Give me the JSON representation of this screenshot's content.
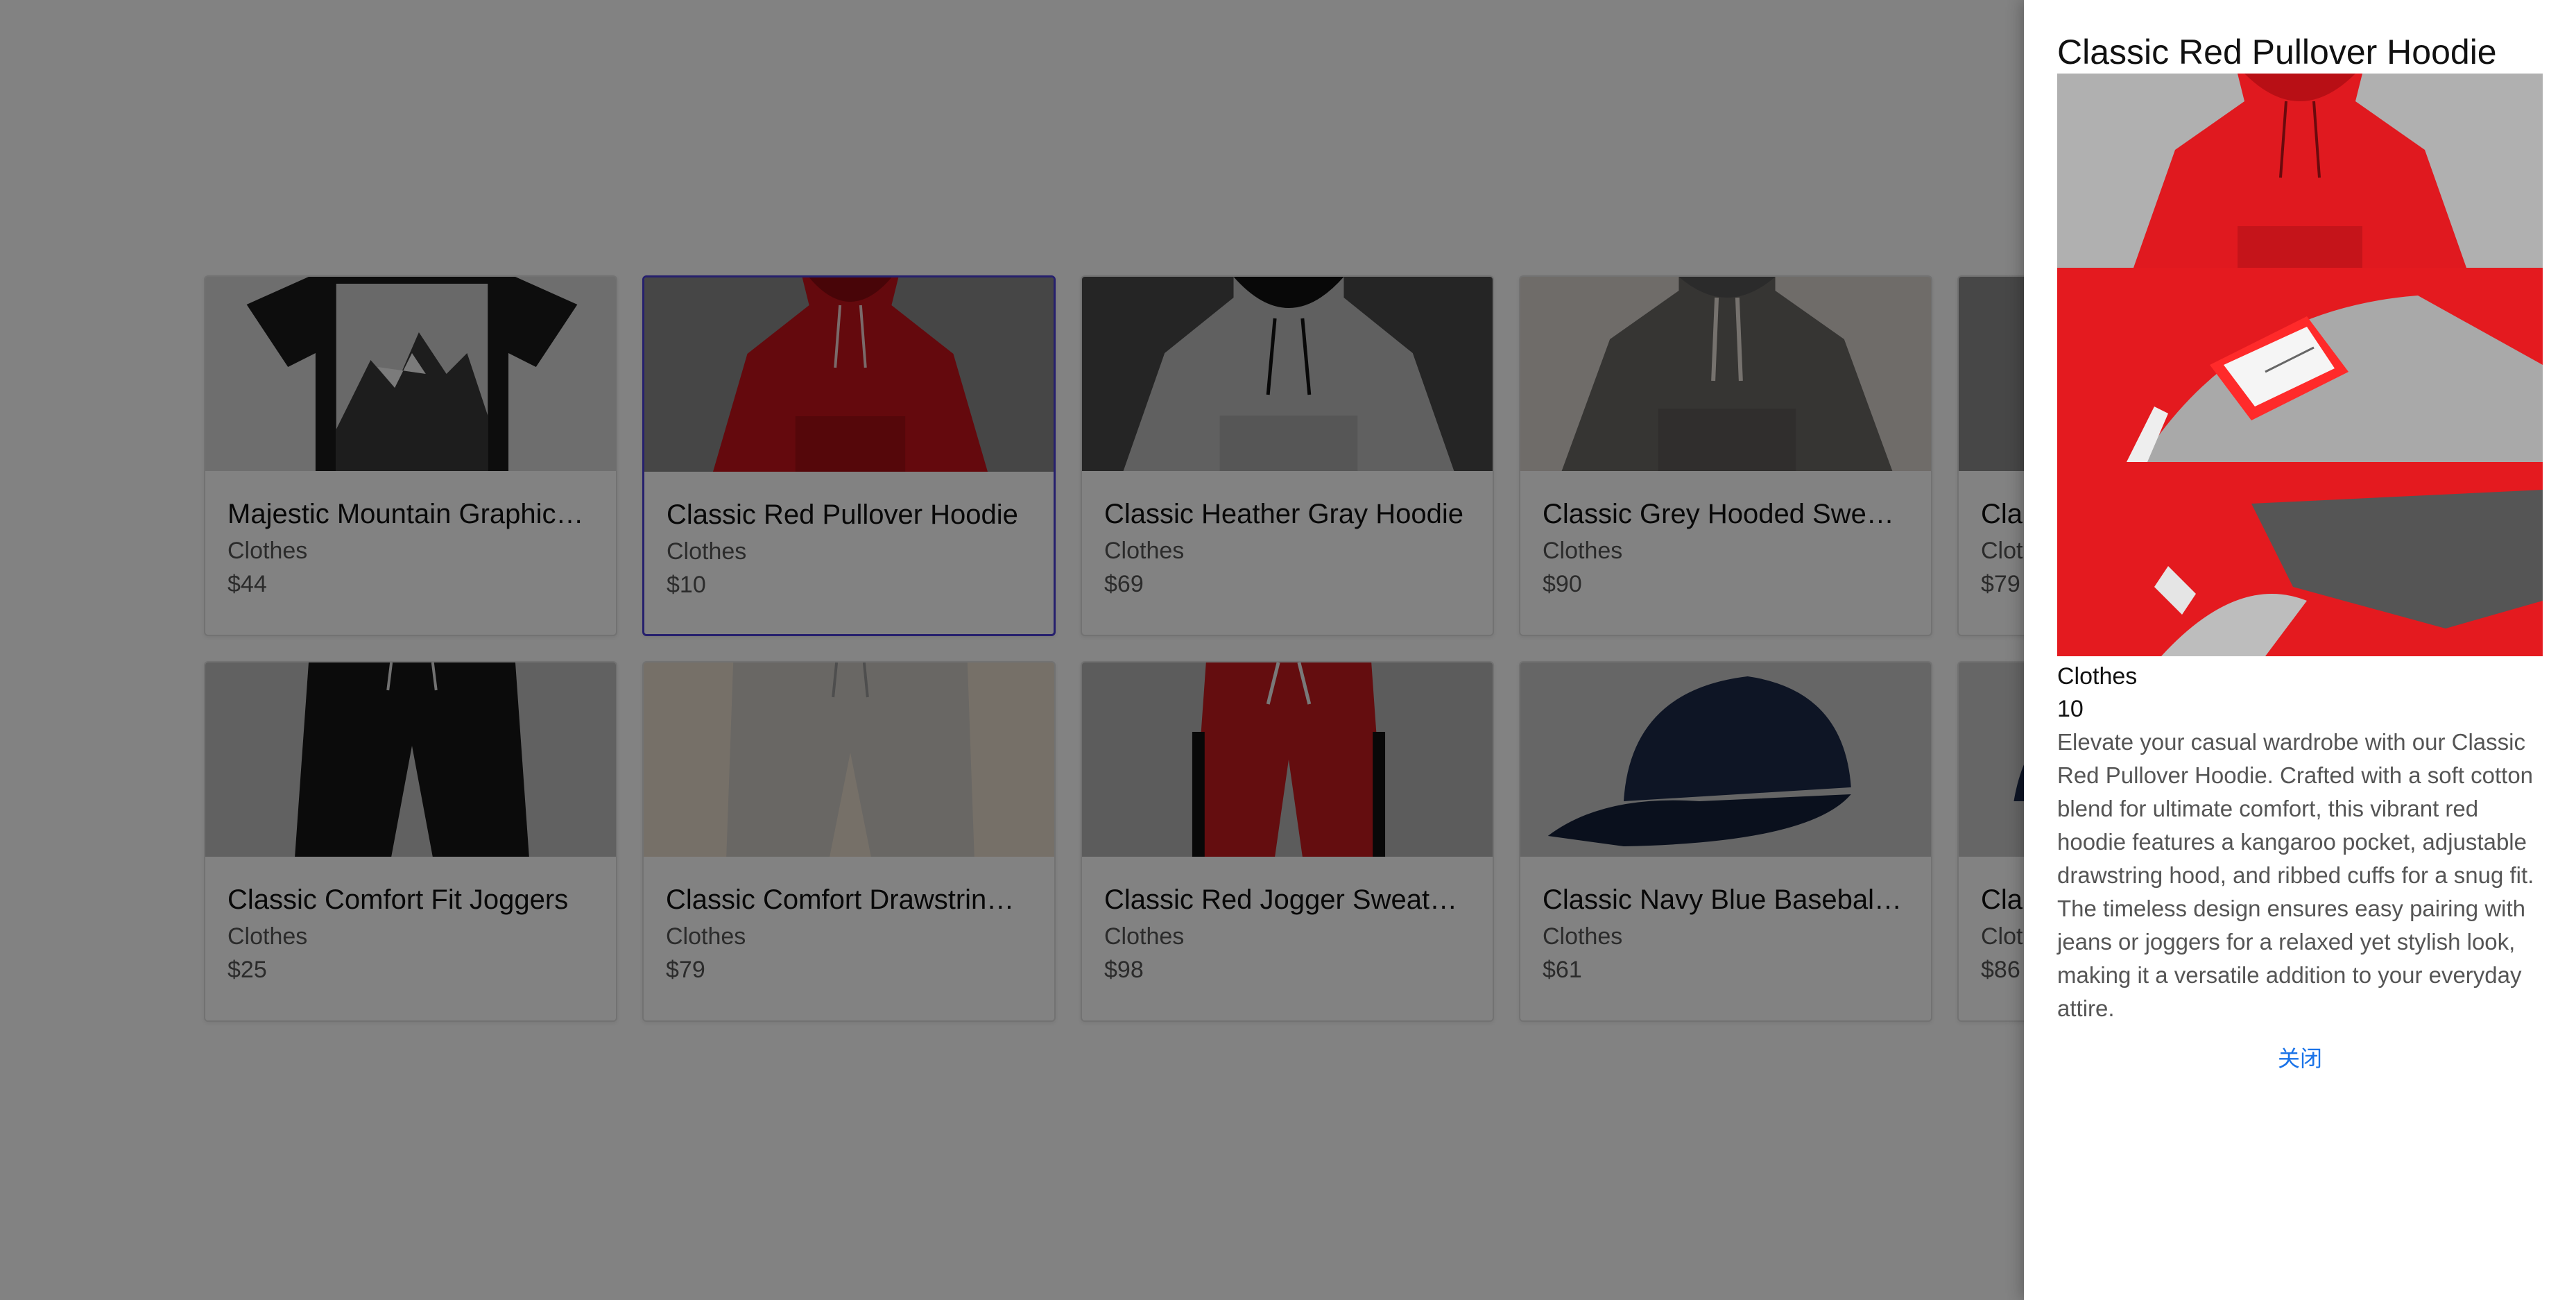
{
  "products": [
    {
      "title": "Majestic Mountain Graphic…",
      "category": "Clothes",
      "price": "$44",
      "image": "black-tshirt-mountain-graphic"
    },
    {
      "title": "Classic Red Pullover Hoodie",
      "category": "Clothes",
      "price": "$10",
      "image": "red-hoodie"
    },
    {
      "title": "Classic Heather Gray Hoodie",
      "category": "Clothes",
      "price": "$69",
      "image": "gray-hoodie"
    },
    {
      "title": "Classic Grey Hooded Swe…",
      "category": "Clothes",
      "price": "$90",
      "image": "grey-hooded-sweatshirt"
    },
    {
      "title": "Cla",
      "category": "Clot",
      "price": "$79",
      "image": "partial-product"
    },
    {
      "title": "Classic Comfort Fit Joggers",
      "category": "Clothes",
      "price": "$25",
      "image": "black-joggers"
    },
    {
      "title": "Classic Comfort Drawstrin…",
      "category": "Clothes",
      "price": "$79",
      "image": "beige-drawstring-pants"
    },
    {
      "title": "Classic Red Jogger Sweat…",
      "category": "Clothes",
      "price": "$98",
      "image": "red-joggers"
    },
    {
      "title": "Classic Navy Blue Basebal…",
      "category": "Clothes",
      "price": "$61",
      "image": "navy-baseball-cap"
    },
    {
      "title": "Cla",
      "category": "Clot",
      "price": "$86",
      "image": "partial-product"
    }
  ],
  "selected_index": 1,
  "drawer": {
    "title": "Classic Red Pullover Hoodie",
    "images": [
      "red-hoodie-front",
      "red-hoodie-label",
      "red-hoodie-hood-detail"
    ],
    "category": "Clothes",
    "price": "10",
    "description": "Elevate your casual wardrobe with our Classic Red Pullover Hoodie. Crafted with a soft cotton blend for ultimate comfort, this vibrant red hoodie features a kangaroo pocket, adjustable drawstring hood, and ribbed cuffs for a snug fit. The timeless design ensures easy pairing with jeans or joggers for a relaxed yet stylish look, making it a versatile addition to your everyday attire.",
    "close_label": "关闭"
  },
  "colors": {
    "accent": "#1a73e8",
    "selected_border": "#4b3fd6",
    "overlay": "rgba(0,0,0,0.49)"
  }
}
